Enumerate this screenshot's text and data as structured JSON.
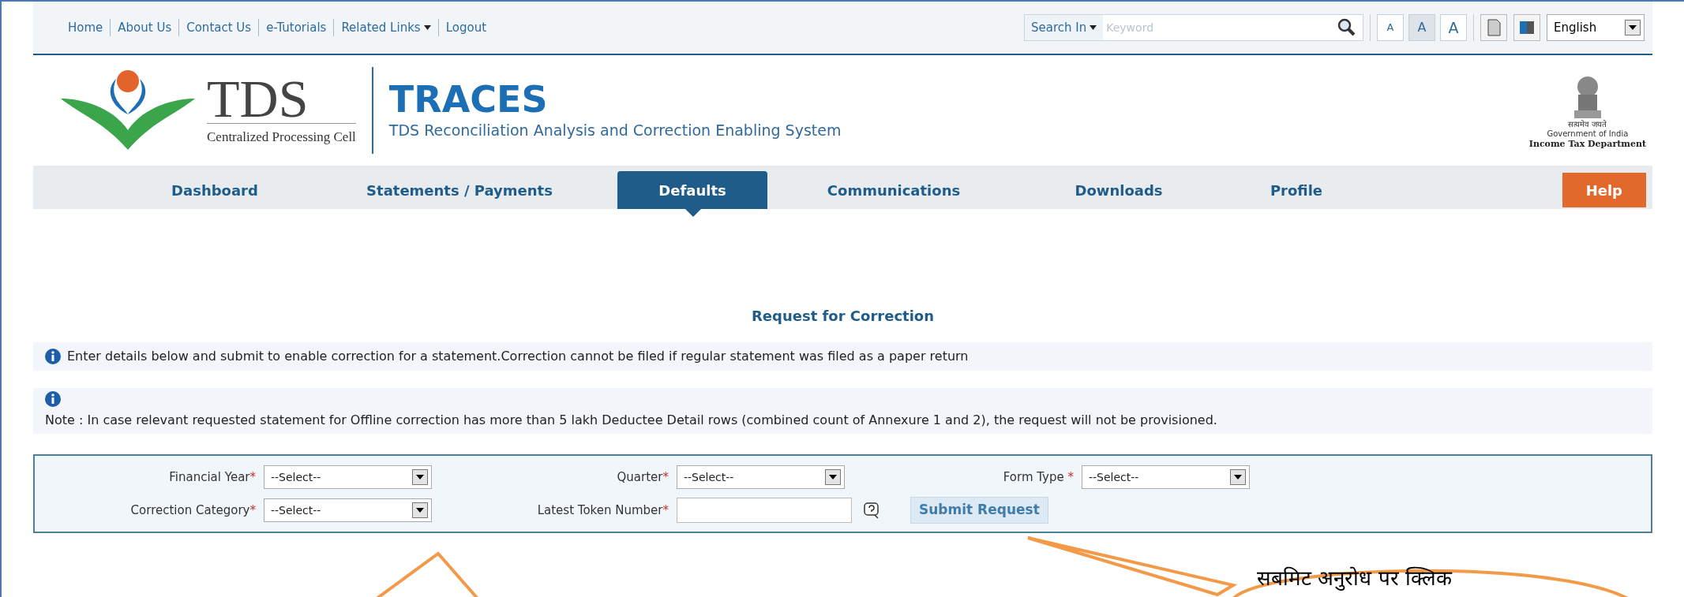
{
  "top_links": [
    "Home",
    "About Us",
    "Contact Us",
    "e-Tutorials",
    {
      "label": "Related Links",
      "dropdown": true
    },
    "Logout"
  ],
  "search": {
    "scope": "Search In",
    "placeholder": "Keyword"
  },
  "font_size_buttons": [
    {
      "label": "A",
      "selected": false
    },
    {
      "label": "A",
      "selected": true
    },
    {
      "label": "A",
      "selected": false
    }
  ],
  "language": "English",
  "logo": {
    "text": "TDS",
    "subtitle": "Centralized Processing Cell"
  },
  "app": {
    "title": "TRACES",
    "subtitle": "TDS Reconciliation Analysis and Correction Enabling System"
  },
  "emblem": {
    "motto": "सत्यमेव जयते",
    "line1": "Government of India",
    "line2": "Income Tax Department"
  },
  "nav": [
    {
      "label": "Dashboard",
      "kind": "tab",
      "selected": false
    },
    {
      "label": "Statements / Payments",
      "kind": "tab",
      "selected": false
    },
    {
      "label": "Defaults",
      "kind": "tab",
      "selected": true
    },
    {
      "label": "Communications",
      "kind": "tab",
      "selected": false
    },
    {
      "label": "Downloads",
      "kind": "tab",
      "selected": false
    },
    {
      "label": "Profile",
      "kind": "tab",
      "selected": false
    }
  ],
  "help": "Help",
  "page_title": "Request for Correction",
  "info": "Enter details below and submit to enable correction for a statement.Correction cannot be filed if regular statement was filed as a paper return",
  "note": "Note : In case relevant requested statement for Offline correction has more than 5 lakh Deductee Detail rows (combined count of Annexure 1 and 2), the request will not be provisioned.",
  "form_rows": [
    [
      {
        "label": "Financial Year",
        "mark": "*",
        "kind": "select",
        "value": "--Select--"
      },
      {
        "label": "Quarter",
        "mark": "*",
        "kind": "select",
        "value": "--Select--"
      },
      {
        "label": "Form Type",
        "mark": " *",
        "kind": "select",
        "value": "--Select--"
      }
    ],
    [
      {
        "label": "Correction Category",
        "mark": "*",
        "kind": "select",
        "value": "--Select--"
      },
      {
        "label": "Latest Token Number",
        "mark": "*",
        "kind": "text"
      }
    ]
  ],
  "submit": "Submit Request",
  "callout": {
    "text": "सबमिट अनुरोध पर क्लिक"
  }
}
